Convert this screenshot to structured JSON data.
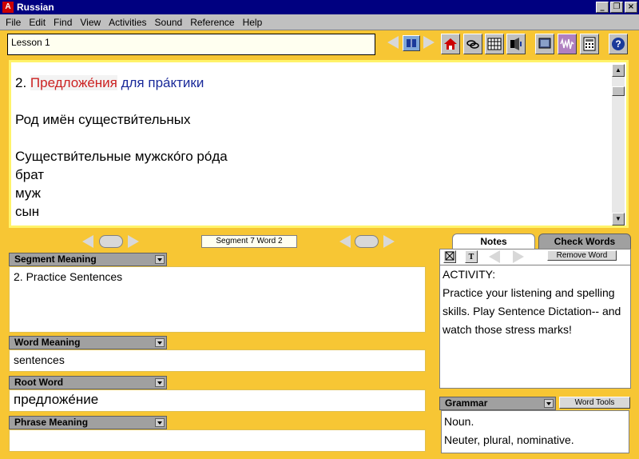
{
  "window": {
    "title": "Russian",
    "app_icon": "A"
  },
  "menu": [
    "File",
    "Edit",
    "Find",
    "View",
    "Activities",
    "Sound",
    "Reference",
    "Help"
  ],
  "lesson": {
    "value": "Lesson 1"
  },
  "main_text": {
    "heading_number": "2. ",
    "heading_red": "Предложе́ния",
    "heading_blue": " для пра́ктики",
    "line2": "Род имён существи́тельных",
    "line3": "Существи́тельные мужско́го ро́да",
    "words": [
      "брат",
      "муж",
      "сын"
    ]
  },
  "segment_indicator": "Segment 7  Word 2",
  "segment_meaning": {
    "label": "Segment Meaning",
    "value": "2. Practice Sentences"
  },
  "word_meaning": {
    "label": "Word Meaning",
    "value": "sentences"
  },
  "root_word": {
    "label": "Root Word",
    "value": "предложе́ние"
  },
  "phrase_meaning": {
    "label": "Phrase Meaning",
    "value": ""
  },
  "tabs": {
    "notes": "Notes",
    "check_words": "Check Words"
  },
  "remove_word": "Remove Word",
  "notes_text": {
    "line1": "ACTIVITY:",
    "line2": "Practice your listening and spelling skills. Play Sentence Dictation-- and watch those stress marks!"
  },
  "grammar": {
    "label": "Grammar",
    "word_tools": "Word Tools",
    "line1": "Noun.",
    "line2": "Neuter, plural, nominative."
  },
  "colors": {
    "background": "#f7c634",
    "title_bar": "#000080",
    "red_text": "#cc2222",
    "blue_text": "#1a2a9a"
  }
}
